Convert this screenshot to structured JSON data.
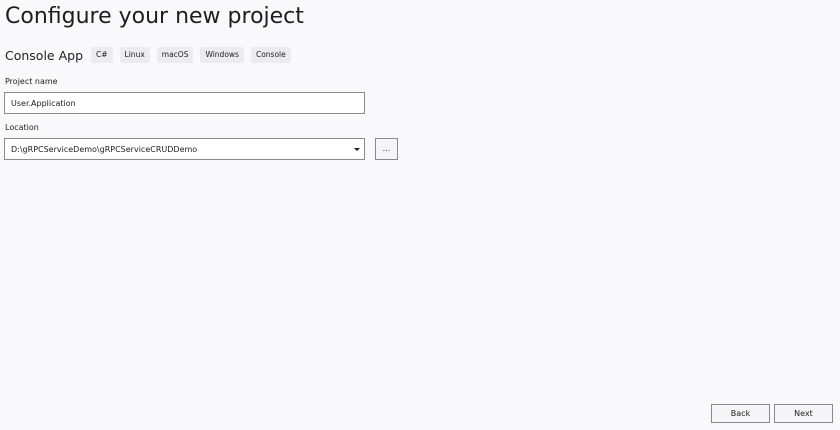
{
  "header": {
    "title": "Configure your new project"
  },
  "template": {
    "name": "Console App",
    "tags": [
      "C#",
      "Linux",
      "macOS",
      "Windows",
      "Console"
    ]
  },
  "form": {
    "project_name_label": "Project name",
    "project_name_value": "User.Application",
    "location_label": "Location",
    "location_value": "D:\\gRPCServiceDemo\\gRPCServiceCRUDDemo",
    "browse_label": "..."
  },
  "footer": {
    "back_label": "Back",
    "next_label": "Next"
  }
}
